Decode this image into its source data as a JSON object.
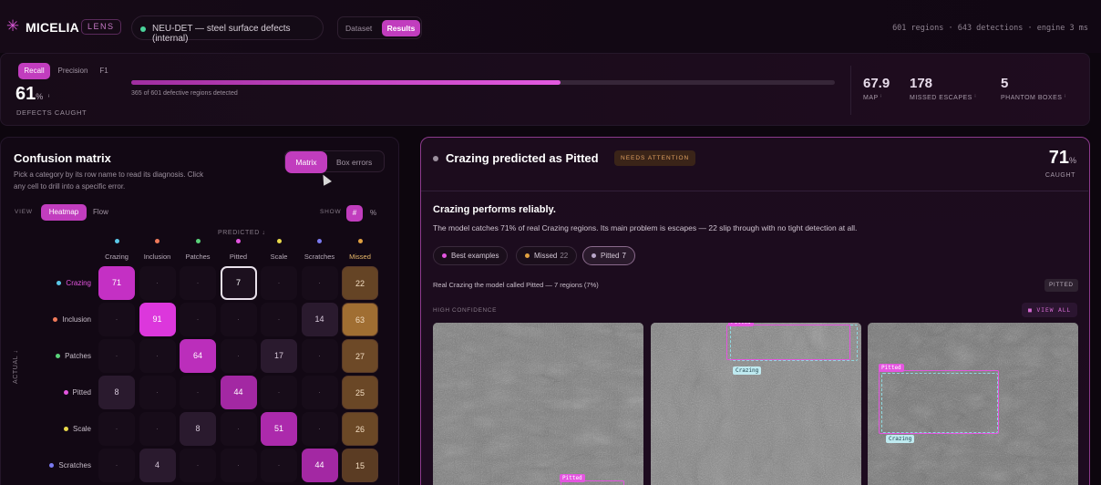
{
  "app": {
    "brand": "MICELIA",
    "badge": "LENS",
    "dataset": "NEU-DET — steel surface defects (internal)",
    "tabs": [
      "Dataset",
      "Results"
    ],
    "active_tab": "Results",
    "run_stats": "601 regions · 643 detections · engine 3 ms"
  },
  "metrics": {
    "tabs": [
      "Recall",
      "Precision",
      "F1"
    ],
    "active": "Recall",
    "value": "61",
    "unit": "%",
    "caption": "DEFECTS CAUGHT",
    "progress": 0.61,
    "progress_note": "365 of 601 defective regions detected",
    "kpis": [
      {
        "value": "67.9",
        "label": "MAP",
        "color": "#d98ad6"
      },
      {
        "value": "178",
        "label": "MISSED ESCAPES",
        "color": "#ffffff"
      },
      {
        "value": "5",
        "label": "PHANTOM BOXES",
        "color": "#f0c070"
      }
    ]
  },
  "matrix": {
    "title": "Confusion matrix",
    "desc": "Pick a category by its row name to read its diagnosis. Click any cell to drill into a specific error.",
    "modes": [
      "Matrix",
      "Box errors"
    ],
    "view_label": "VIEW",
    "views": [
      "Heatmap",
      "Flow"
    ],
    "show_label": "SHOW",
    "shows": [
      "#",
      "%"
    ],
    "predicted_label": "PREDICTED ↓",
    "actual_label": "ACTUAL ↓",
    "columns": [
      {
        "name": "Crazing",
        "color": "#5ac8e8"
      },
      {
        "name": "Inclusion",
        "color": "#f07a5a"
      },
      {
        "name": "Patches",
        "color": "#5ad27a"
      },
      {
        "name": "Pitted",
        "color": "#e455e0"
      },
      {
        "name": "Scale",
        "color": "#e8d84a"
      },
      {
        "name": "Scratches",
        "color": "#7a7af0"
      },
      {
        "name": "Missed",
        "color": "#e0a040"
      }
    ],
    "rows": [
      {
        "name": "Crazing",
        "color": "#5ac8e8",
        "cells": [
          "71",
          "·",
          "·",
          "7",
          "·",
          "·",
          "22"
        ]
      },
      {
        "name": "Inclusion",
        "color": "#f07a5a",
        "cells": [
          "·",
          "91",
          "·",
          "·",
          "·",
          "14",
          "63"
        ]
      },
      {
        "name": "Patches",
        "color": "#5ad27a",
        "cells": [
          "·",
          "·",
          "64",
          "·",
          "17",
          "·",
          "27"
        ]
      },
      {
        "name": "Pitted",
        "color": "#e455e0",
        "cells": [
          "8",
          "·",
          "·",
          "44",
          "·",
          "·",
          "25"
        ]
      },
      {
        "name": "Scale",
        "color": "#e8d84a",
        "cells": [
          "·",
          "·",
          "8",
          "·",
          "51",
          "·",
          "26"
        ]
      },
      {
        "name": "Scratches",
        "color": "#7a7af0",
        "cells": [
          "·",
          "4",
          "·",
          "·",
          "·",
          "44",
          "15"
        ]
      }
    ]
  },
  "detail": {
    "title": "Crazing predicted as Pitted",
    "badge": "NEEDS ATTENTION",
    "pct": "71",
    "unit": "%",
    "caught_label": "CAUGHT",
    "headline": "Crazing performs reliably.",
    "text": "The model catches 71% of real Crazing regions. Its main problem is escapes — 22 slip through with no tight detection at all.",
    "chips": [
      {
        "label": "Best examples",
        "count": "",
        "color": "#e455e0"
      },
      {
        "label": "Missed",
        "count": "22",
        "color": "#e0a040"
      },
      {
        "label": "Pitted",
        "count": "7",
        "color": "#b9a6c9"
      }
    ],
    "sub": "Real Crazing the model called Pitted — 7 regions (7%)",
    "tag": "PITTED",
    "confidence_label": "HIGH CONFIDENCE",
    "view_all": "■ VIEW ALL",
    "box_labels": {
      "pred": "Pitted",
      "gt": "Crazing"
    }
  }
}
